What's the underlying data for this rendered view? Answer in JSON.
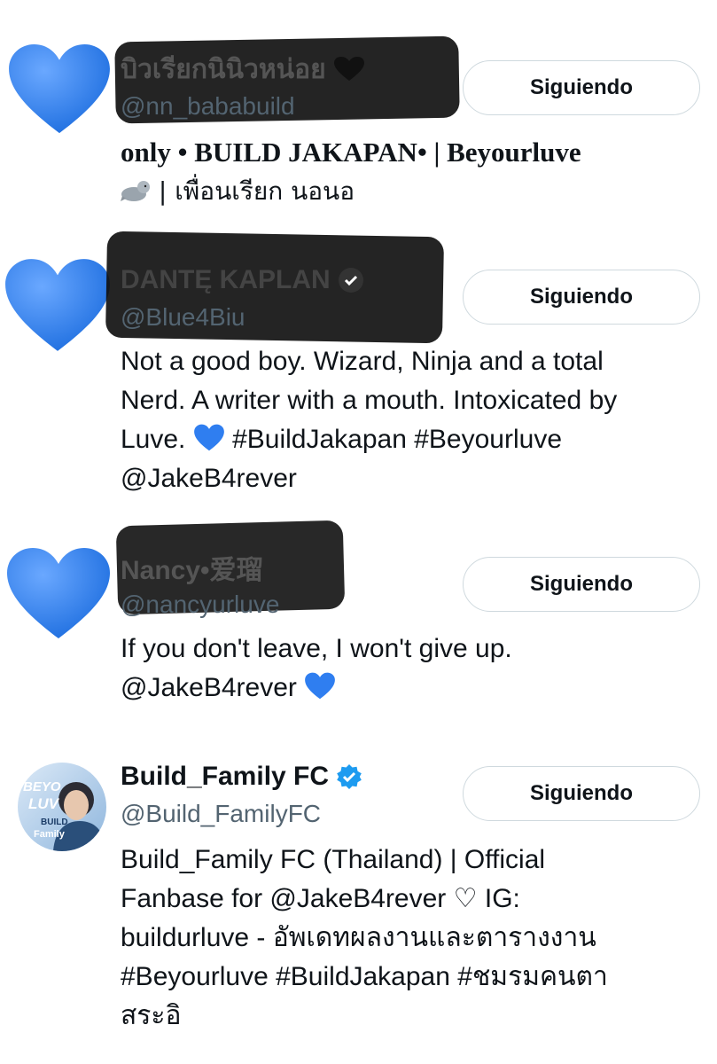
{
  "accounts": [
    {
      "name": "บิวเรียกนินิวหน่อย",
      "handle": "@nn_bababuild",
      "bio": "only • BUILD JAKAPAN• | Beyourluve",
      "bio2": "| เพื่อนเรียก นอนอ",
      "follow_label": "Siguiendo"
    },
    {
      "name": "DANTĘ KAPLAN",
      "handle": "@Blue4Biu",
      "bio_line1": "Not a good boy. Wizard, Ninja and a total",
      "bio_line2": "Nerd. A writer with a mouth. Intoxicated by",
      "bio_line3a": "Luve.",
      "bio_line3b": "#BuildJakapan #Beyourluve",
      "bio_line4": "@JakeB4rever",
      "follow_label": "Siguiendo"
    },
    {
      "name": "Nancy•爱瑠",
      "handle": "@nancyurluve",
      "bio_line1": "If you don't leave, I won't give up.",
      "bio_line2": "@JakeB4rever",
      "follow_label": "Siguiendo"
    },
    {
      "name": "Build_Family FC",
      "handle": "@Build_FamilyFC",
      "bio_line1": "Build_Family FC (Thailand) | Official",
      "bio_line2": "Fanbase for @JakeB4rever ♡ IG:",
      "bio_line3": "buildurluve - อัพเดทผลงานและตารางงาน",
      "bio_line4": "#Beyourluve #BuildJakapan #ชมรมคนตา",
      "bio_line5": "สระอิ",
      "avatar_text_1": "BEYO",
      "avatar_text_2": "LUV",
      "avatar_text_3": "BUILD",
      "avatar_text_4": "Family",
      "follow_label": "Siguiendo"
    }
  ],
  "colors": {
    "heart_blue": "#3b82f6",
    "verified_blue": "#1d9bf0",
    "muted_text": "#536471",
    "border": "#cfd9de"
  },
  "icons": [
    "blue-heart-icon",
    "verified-badge-icon",
    "seal-icon",
    "black-heart-icon"
  ]
}
